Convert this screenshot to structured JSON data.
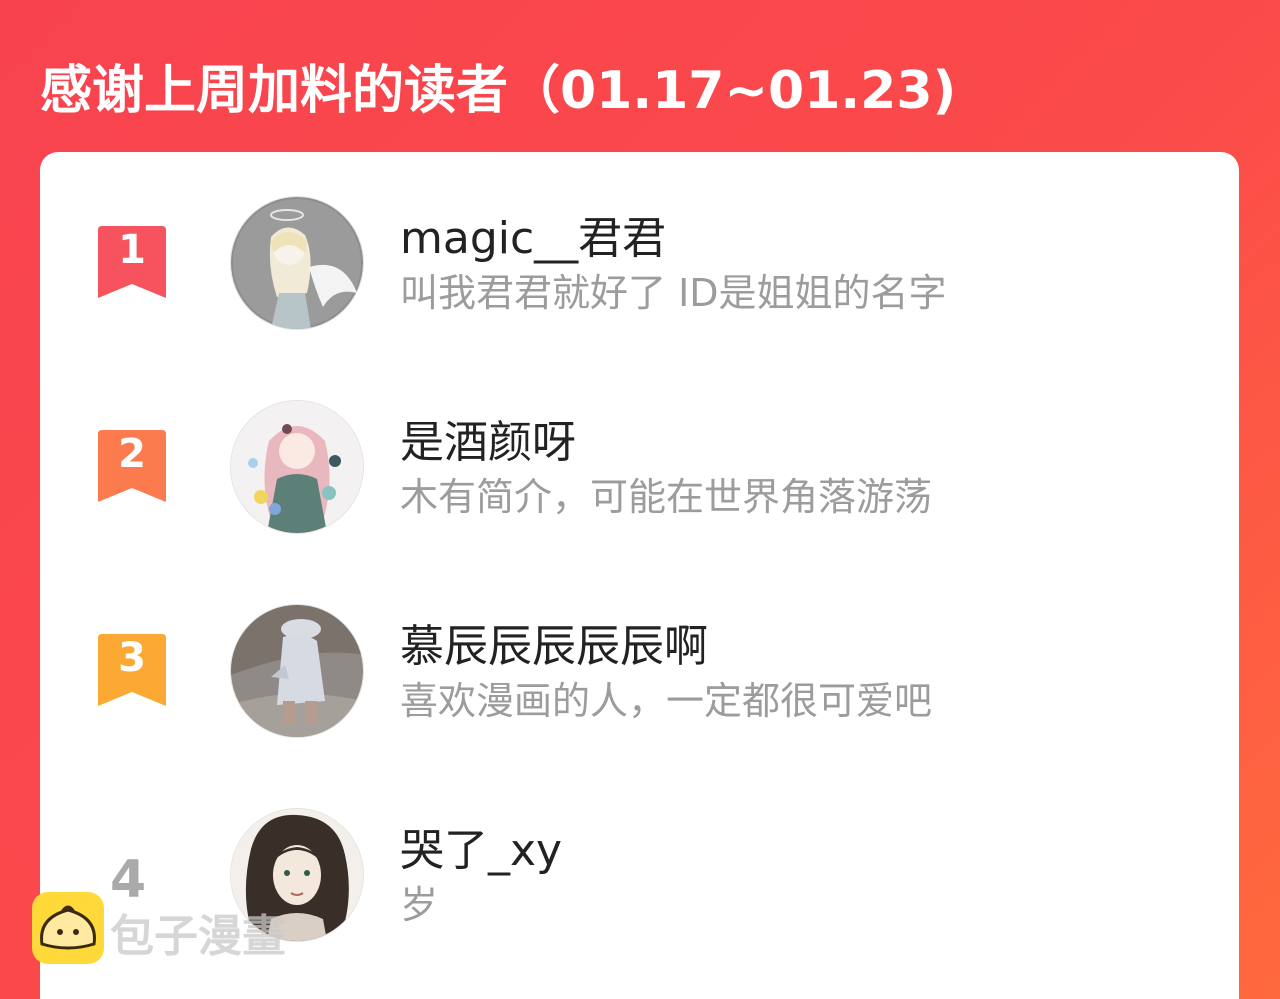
{
  "header": {
    "title": "感谢上周加料的读者（01.17~01.23)"
  },
  "colors": {
    "background": "#f8434f",
    "rank1": "#f6535e",
    "rank2": "#fb7b4f",
    "rank3": "#fba933",
    "rank_plain": "#aaaaaa",
    "name": "#222222",
    "bio": "#9c9c9c"
  },
  "readers": [
    {
      "rank": "1",
      "name": "magic__君君",
      "bio": "叫我君君就好了 ID是姐姐的名字",
      "avatar": "anime-angel-avatar"
    },
    {
      "rank": "2",
      "name": "是酒颜呀",
      "bio": "木有简介，可能在世界角落游荡",
      "avatar": "anime-girl-flowers-avatar"
    },
    {
      "rank": "3",
      "name": "慕辰辰辰辰辰啊",
      "bio": "喜欢漫画的人，一定都很可爱吧",
      "avatar": "photo-child-avatar"
    },
    {
      "rank": "4",
      "name": "哭了_xy",
      "bio": "岁",
      "avatar": "curly-hair-girl-avatar"
    }
  ],
  "watermark": {
    "text": "包子漫畫",
    "icon": "bun-icon"
  }
}
